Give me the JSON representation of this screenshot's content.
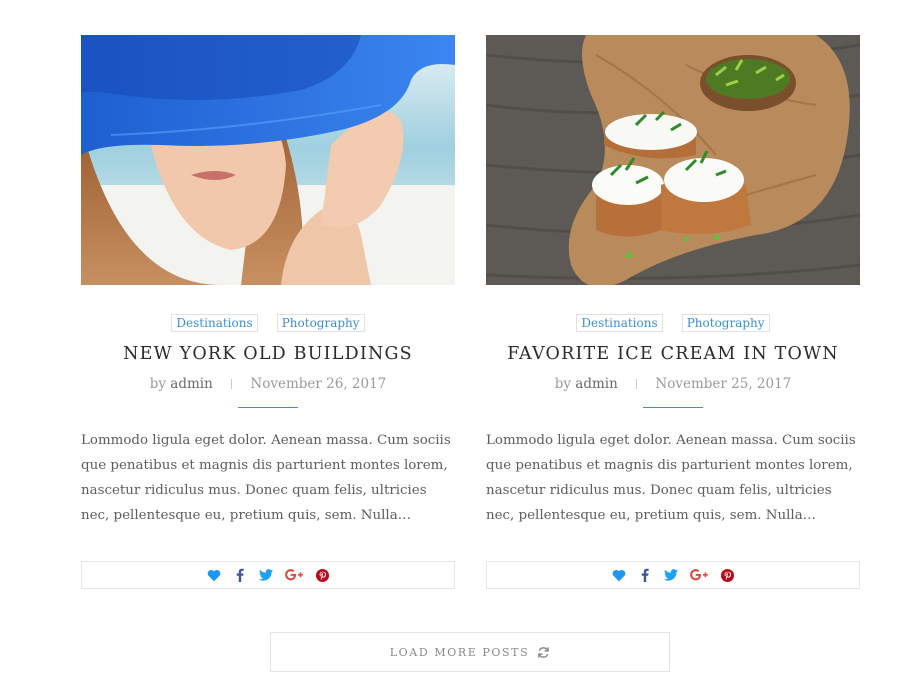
{
  "posts": [
    {
      "categories": [
        "Destinations",
        "Photography"
      ],
      "title": "NEW YORK OLD BUILDINGS",
      "by": "by",
      "author": "admin",
      "date": "November 26, 2017",
      "excerpt": "Lommodo ligula eget dolor. Aenean massa. Cum sociis que penatibus et magnis dis parturient montes lorem, nascetur ridiculus mus. Donec quam felis, ultricies nec, pellentesque eu, pretium quis, sem. Nulla…"
    },
    {
      "categories": [
        "Destinations",
        "Photography"
      ],
      "title": "FAVORITE ICE CREAM IN TOWN",
      "by": "by",
      "author": "admin",
      "date": "November 25, 2017",
      "excerpt": "Lommodo ligula eget dolor. Aenean massa. Cum sociis que penatibus et magnis dis parturient montes lorem, nascetur ridiculus mus. Donec quam felis, ultricies nec, pellentesque eu, pretium quis, sem. Nulla…"
    }
  ],
  "share_icons": [
    "heart-icon",
    "facebook-icon",
    "twitter-icon",
    "google-plus-icon",
    "pinterest-icon"
  ],
  "colors": {
    "accent": "#3b8fd6",
    "heart": "#2196f3",
    "facebook": "#3b5998",
    "twitter": "#1da1f2",
    "google": "#dd4b39",
    "pinterest": "#bd081c"
  },
  "load_more": {
    "label": "LOAD MORE POSTS",
    "icon": "refresh-icon"
  }
}
